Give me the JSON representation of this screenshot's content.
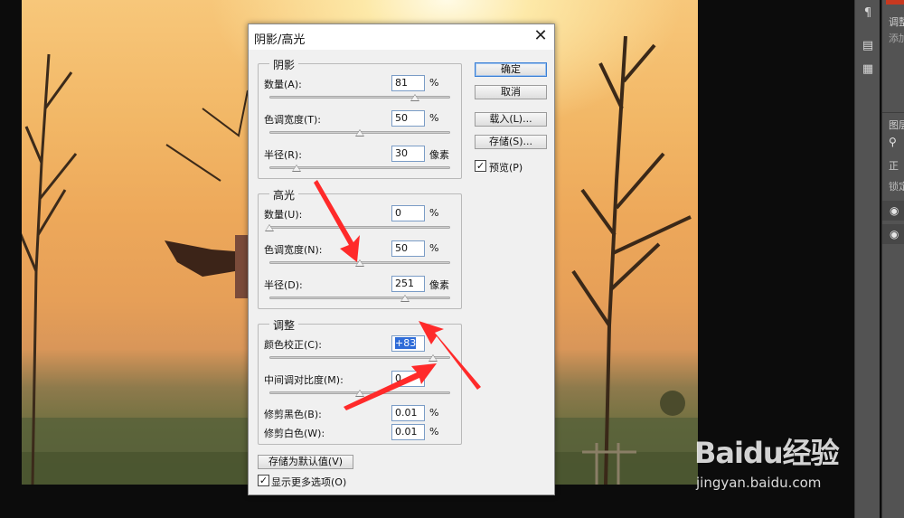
{
  "dialog": {
    "title": "阴影/高光",
    "close_glyph": "✕",
    "shadows": {
      "legend": "阴影",
      "amount_label": "数量(A):",
      "amount_value": "81",
      "amount_unit": "%",
      "amount_level": 81,
      "tonal_label": "色调宽度(T):",
      "tonal_value": "50",
      "tonal_unit": "%",
      "tonal_level": 50,
      "radius_label": "半径(R):",
      "radius_value": "30",
      "radius_unit": "像素",
      "radius_level": 30
    },
    "highlights": {
      "legend": "高光",
      "amount_label": "数量(U):",
      "amount_value": "0",
      "amount_unit": "%",
      "amount_level": 0,
      "tonal_label": "色调宽度(N):",
      "tonal_value": "50",
      "tonal_unit": "%",
      "tonal_level": 50,
      "radius_label": "半径(D):",
      "radius_value": "251",
      "radius_unit": "像素",
      "radius_level": 251
    },
    "adjust": {
      "legend": "调整",
      "color_label": "颜色校正(C):",
      "color_value": "+83",
      "color_level": 83,
      "midtone_label": "中间调对比度(M):",
      "midtone_value": "0",
      "midtone_level": 0,
      "black_label": "修剪黑色(B):",
      "black_value": "0.01",
      "black_unit": "%",
      "white_label": "修剪白色(W):",
      "white_value": "0.01",
      "white_unit": "%"
    },
    "buttons": {
      "ok": "确定",
      "cancel": "取消",
      "load": "载入(L)...",
      "save": "存储(S)...",
      "preview": "预览(P)",
      "save_default": "存储为默认值(V)",
      "more_options": "显示更多选项(O)"
    },
    "preview_checked": true,
    "more_options_checked": true
  },
  "side_panel": {
    "adjust_tab": "调整",
    "add_text": "添加",
    "layers_tab": "图层",
    "normal": "正",
    "lock": "锁定"
  },
  "watermark": {
    "logo": "Baidu经验",
    "url": "jingyan.baidu.com"
  },
  "colors": {
    "arrow": "#ff2a2a",
    "accent": "#2f6cd8"
  }
}
